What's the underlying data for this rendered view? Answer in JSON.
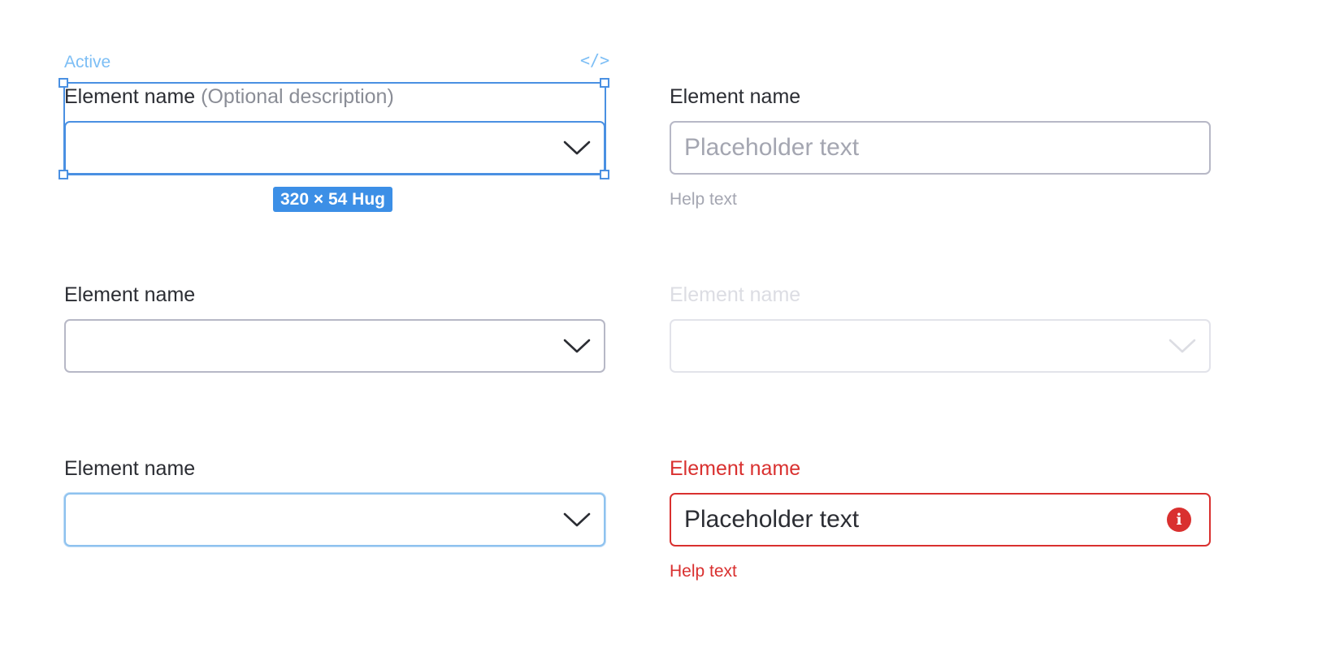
{
  "annotation": {
    "state_tag": "Active",
    "code_icon": "code-brackets-icon",
    "size_badge": "320 × 54 Hug"
  },
  "fields": [
    {
      "id": "active",
      "label": "Element name",
      "label_suffix": "(Optional description)",
      "value": "",
      "icon": "chevron-down-icon"
    },
    {
      "id": "input-default",
      "label": "Element name",
      "placeholder": "Placeholder text",
      "help_text": "Help text"
    },
    {
      "id": "select-default",
      "label": "Element name",
      "value": "",
      "icon": "chevron-down-icon"
    },
    {
      "id": "select-disabled",
      "label": "Element name",
      "value": "",
      "icon": "chevron-down-icon"
    },
    {
      "id": "select-focus",
      "label": "Element name",
      "value": "",
      "icon": "chevron-down-icon"
    },
    {
      "id": "input-error",
      "label": "Element name",
      "value": "Placeholder text",
      "help_text": "Help text",
      "icon": "error-info-icon"
    }
  ],
  "colors": {
    "text": "#2b2d33",
    "muted": "#8a8d96",
    "placeholder": "#a4a6b1",
    "border": "#b7b8c6",
    "disabled": "#dcdde3",
    "selection": "#4a90e2",
    "badge": "#3c8fe6",
    "error": "#d9302f"
  }
}
